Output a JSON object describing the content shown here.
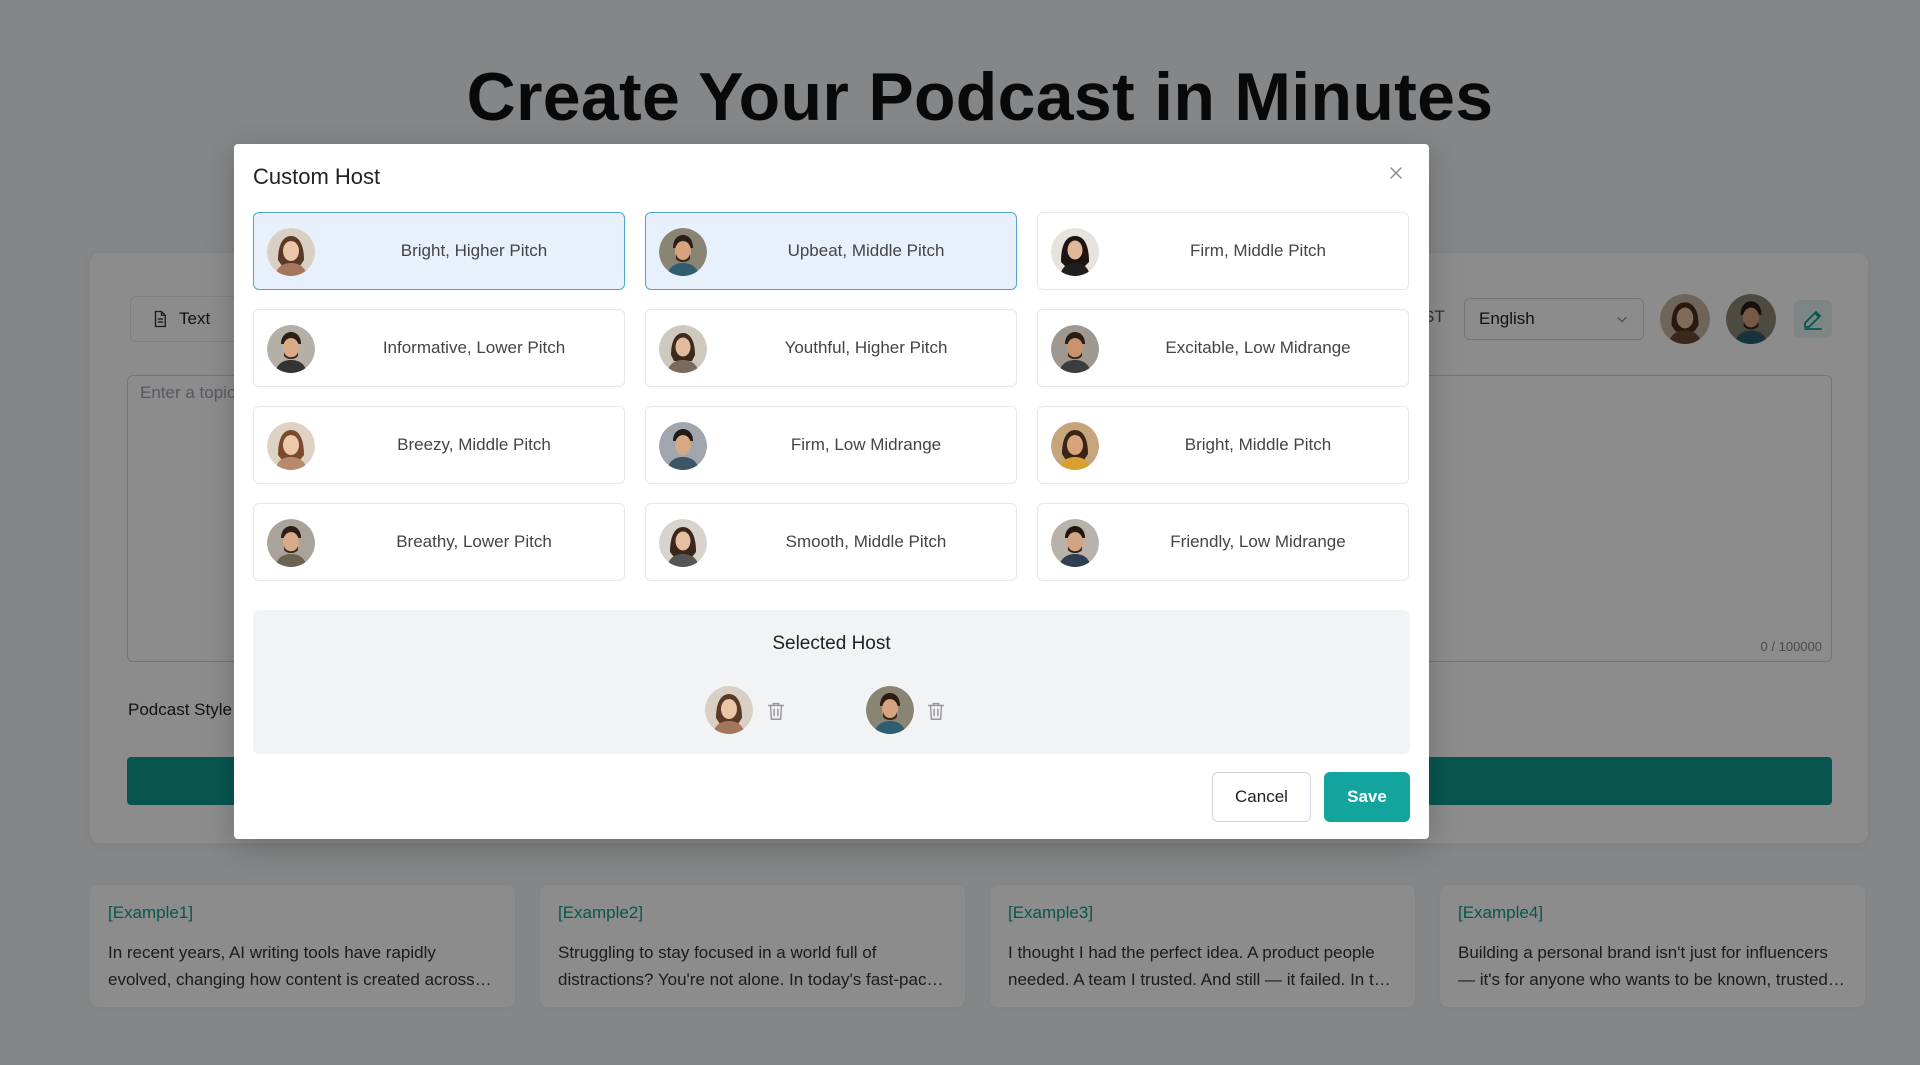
{
  "page": {
    "title": "Create Your Podcast in Minutes",
    "text_tab": "Text",
    "lang_suffix": "ST",
    "language": "English",
    "topic_placeholder": "Enter a topic",
    "char_count": "0 / 100000",
    "podcast_style_label": "Podcast Style"
  },
  "examples": [
    {
      "tag": "[Example1]",
      "text": "In recent years, AI writing tools have rapidly evolved, changing how content is created across industries. From drafting emails to generating full articles"
    },
    {
      "tag": "[Example2]",
      "text": "Struggling to stay focused in a world full of distractions? You're not alone. In today's fast-paced digital age, our attention is constantly pulled"
    },
    {
      "tag": "[Example3]",
      "text": "I thought I had the perfect idea. A product people needed. A team I trusted. And still — it failed. In this episode"
    },
    {
      "tag": "[Example4]",
      "text": "Building a personal brand isn't just for influencers — it's for anyone who wants to be known, trusted, and remembered"
    }
  ],
  "modal": {
    "title": "Custom Host",
    "voices": [
      {
        "label": "Bright, Higher Pitch",
        "selected": true
      },
      {
        "label": "Upbeat, Middle Pitch",
        "selected": true
      },
      {
        "label": "Firm, Middle Pitch",
        "selected": false
      },
      {
        "label": "Informative, Lower Pitch",
        "selected": false
      },
      {
        "label": "Youthful, Higher Pitch",
        "selected": false
      },
      {
        "label": "Excitable, Low Midrange",
        "selected": false
      },
      {
        "label": "Breezy, Middle Pitch",
        "selected": false
      },
      {
        "label": "Firm, Low Midrange",
        "selected": false
      },
      {
        "label": "Bright, Middle Pitch",
        "selected": false
      },
      {
        "label": "Breathy, Lower Pitch",
        "selected": false
      },
      {
        "label": "Smooth, Middle Pitch",
        "selected": false
      },
      {
        "label": "Friendly, Low Midrange",
        "selected": false
      }
    ],
    "selected_title": "Selected Host",
    "cancel_label": "Cancel",
    "save_label": "Save"
  },
  "colors": {
    "accent": "#13a59d",
    "selected_card_bg": "#e8f1fb",
    "selected_card_border": "#4fa7c9",
    "overlay": "rgba(0,0,0,0.45)"
  }
}
